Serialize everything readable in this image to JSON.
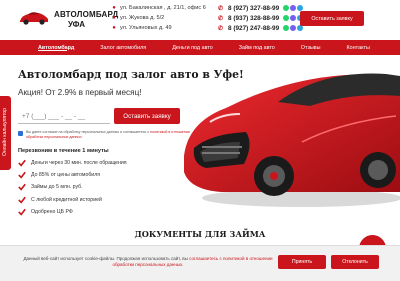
{
  "header": {
    "logo_line1": "АВТОЛОМБАРД",
    "logo_line2": "УФА",
    "addresses": [
      "ул. Бакалинская , д. 21/1, офис 6",
      "ул. Жукова д. 5/2",
      "ул. Ульяновых д. 49"
    ],
    "phones": [
      "8 (927) 327-88-99",
      "8 (937) 328-88-99",
      "8 (927) 247-88-99"
    ],
    "callback_button": "Оставить заявку"
  },
  "nav": {
    "items": [
      "Автоломбард",
      "Залог автомобиля",
      "Деньги под авто",
      "Займ под авто",
      "Отзывы",
      "Контакты"
    ]
  },
  "side_tab": "Онлайн калькулятор",
  "hero": {
    "title": "Автоломбард под залог авто в Уфе!",
    "subtitle": "Акция! От 2.9% в первый месяц!",
    "phone_placeholder": "+7 (___) ___ - __ - __",
    "apply_button": "Оставить заявку",
    "consent_text": "Вы даете согласие на обработку персональных данных и соглашаетесь с ",
    "consent_link": "политикой в отношении обработки персональных данных",
    "callback_label": "Перезвоним в течение 1 минуты",
    "benefits": [
      "Деньги через 30 мин. после обращения",
      "До 85% от цены автомобиля",
      "Займы до 5 млн. руб.",
      "С любой кредитной историей",
      "Одобрено ЦБ РФ"
    ]
  },
  "section": {
    "docs_title": "ДОКУМЕНТЫ ДЛЯ ЗАЙМА"
  },
  "cookie": {
    "text": "Данный веб-сайт использует cookie-файлы. Продолжая использовать сайт, вы ",
    "link": "соглашаетесь с политикой в отношении обработки персональных данных.",
    "accept_button": "Принять",
    "decline_button": "Отклонить"
  },
  "colors": {
    "brand": "#c9151b",
    "nav_background": "#c9151b",
    "cookie_background": "#f1f1f1"
  },
  "icons": {
    "logo": "car-logo-icon",
    "address": "map-pin-icon",
    "phone": "phone-icon",
    "benefit": "check-icon"
  }
}
